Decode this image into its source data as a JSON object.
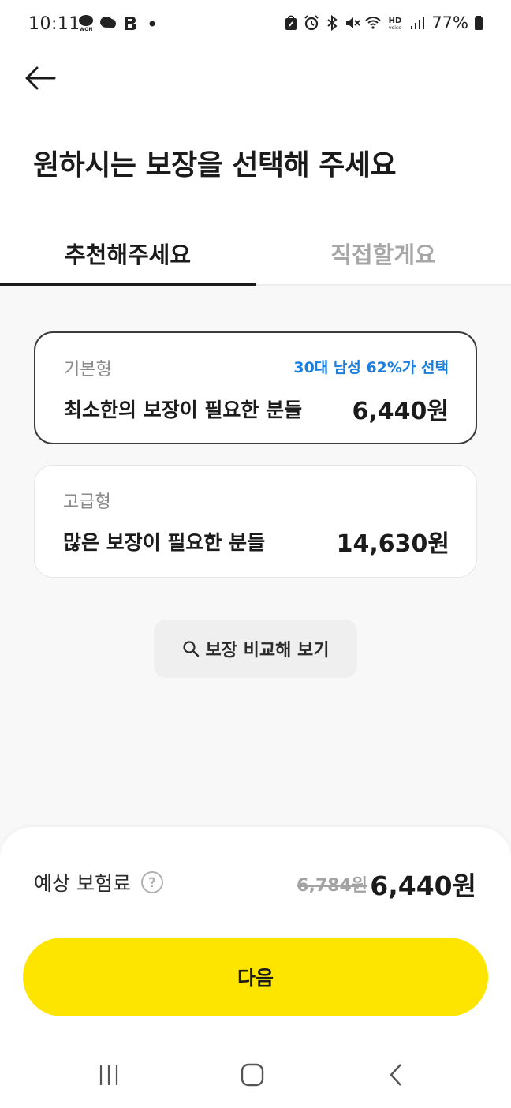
{
  "status_bar": {
    "time": "10:11",
    "battery": "77%",
    "notification_icons": [
      "talk-won-icon",
      "talk-icon",
      "b-icon",
      "dot-icon"
    ],
    "system_icons": [
      "bag-icon",
      "alarm-icon",
      "bluetooth-icon",
      "mute-icon",
      "wifi-icon",
      "hd-voice-icon",
      "signal-icon",
      "battery-icon"
    ]
  },
  "header": {
    "back_icon": "arrow-left-icon",
    "title": "원하시는 보장을 선택해 주세요"
  },
  "tabs": [
    {
      "label": "추천해주세요",
      "selected": true
    },
    {
      "label": "직접할게요",
      "selected": false
    }
  ],
  "plans": [
    {
      "type": "기본형",
      "badge": "30대 남성 62%가 선택",
      "description": "최소한의 보장이 필요한 분들",
      "price": "6,440원",
      "selected": true
    },
    {
      "type": "고급형",
      "badge": "",
      "description": "많은 보장이 필요한 분들",
      "price": "14,630원",
      "selected": false
    }
  ],
  "compare": {
    "icon": "search-icon",
    "label": "보장 비교해 보기"
  },
  "summary": {
    "label": "예상 보험료",
    "help_icon": "question-circle-icon",
    "original_price": "6,784원",
    "final_price": "6,440원"
  },
  "next_button": {
    "label": "다음"
  },
  "nav_bar": {
    "icons": [
      "recents-icon",
      "home-icon",
      "back-icon"
    ]
  },
  "colors": {
    "accent_yellow": "#fee500",
    "badge_blue": "#1b7fe0",
    "selected_border": "#3b3b3b",
    "content_bg": "#f8f8f8"
  }
}
